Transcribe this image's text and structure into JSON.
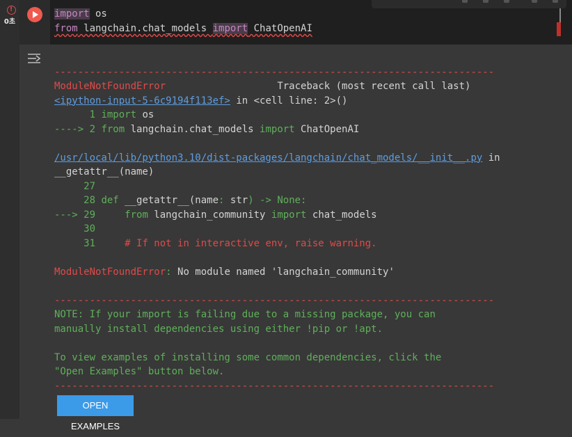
{
  "cell_status": {
    "icon": "!",
    "exec_time": "0초"
  },
  "code": {
    "line1": {
      "kw": "import",
      "rest": " os"
    },
    "line2": {
      "from": "from",
      "module": " langchain.chat_models ",
      "import": "import",
      "rest": " ChatOpenAI"
    }
  },
  "output": {
    "separator": "---------------------------------------------------------------------------",
    "error_name": "ModuleNotFoundError",
    "traceback_header": "Traceback (most recent call last)",
    "input_link": "<ipython-input-5-6c9194f113ef>",
    "input_in": " in ",
    "input_cell": "<cell line: 2>()",
    "src1_num": "      1 ",
    "src1_kw": "import",
    "src1_rest": " os",
    "src2_arrow": "----> 2 ",
    "src2_from": "from",
    "src2_mod": " langchain.chat_models ",
    "src2_import": "import",
    "src2_rest": " ChatOpenAI",
    "file_link": "/usr/local/lib/python3.10/dist-packages/langchain/chat_models/__init__.py",
    "file_in": " in",
    "func_name": "__getattr__(name)",
    "l27": "     27",
    "l28_num": "     28 ",
    "l28_def": "def",
    "l28_fn": " __getattr__(name",
    "l28_colon": ":",
    "l28_str": " str",
    "l28_arrow": ") -> None:",
    "l29_arrow": "---> 29 ",
    "l29_from": "    from",
    "l29_mod": " langchain_community ",
    "l29_import": "import",
    "l29_rest": " chat_models",
    "l30": "     30",
    "l31_num": "     31 ",
    "l31_comment": "    # If not in interactive env, raise warning.",
    "final_error": "ModuleNotFoundError",
    "final_colon": ":",
    "final_msg": " No module named 'langchain_community'",
    "note1": "NOTE: If your import is failing due to a missing package, you can",
    "note2": "manually install dependencies using either !pip or !apt.",
    "note3": "To view examples of installing some common dependencies, click the",
    "note4": "\"Open Examples\" button below."
  },
  "open_examples_label": "OPEN EXAMPLES",
  "colors": {
    "background": "#383838",
    "error_red": "#e04a4a",
    "note_green": "#5fb05a",
    "link_blue": "#5e9de0",
    "button_blue": "#3b9be8"
  }
}
